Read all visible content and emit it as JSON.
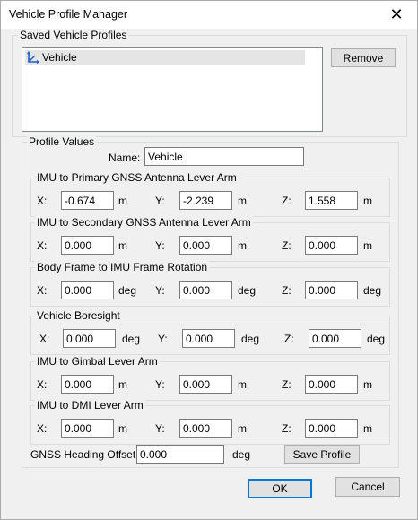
{
  "window": {
    "title": "Vehicle Profile Manager"
  },
  "saved": {
    "legend": "Saved Vehicle Profiles",
    "items": [
      {
        "label": "Vehicle",
        "icon": "axes-icon"
      }
    ],
    "remove_label": "Remove"
  },
  "values": {
    "legend": "Profile Values",
    "name_label": "Name:",
    "name_value": "Vehicle",
    "groups": [
      {
        "title": "IMU to Primary GNSS Antenna Lever Arm",
        "x": "-0.674",
        "y": "-2.239",
        "z": "1.558",
        "unit": "m"
      },
      {
        "title": "IMU to Secondary GNSS Antenna Lever Arm",
        "x": "0.000",
        "y": "0.000",
        "z": "0.000",
        "unit": "m"
      },
      {
        "title": "Body Frame to IMU Frame Rotation",
        "x": "0.000",
        "y": "0.000",
        "z": "0.000",
        "unit": "deg"
      },
      {
        "title": "Vehicle Boresight",
        "x": "0.000",
        "y": "0.000",
        "z": "0.000",
        "unit": "deg"
      },
      {
        "title": "IMU to Gimbal Lever Arm",
        "x": "0.000",
        "y": "0.000",
        "z": "0.000",
        "unit": "m"
      },
      {
        "title": "IMU to DMI Lever Arm",
        "x": "0.000",
        "y": "0.000",
        "z": "0.000",
        "unit": "m"
      }
    ],
    "axis_labels": {
      "x": "X:",
      "y": "Y:",
      "z": "Z:"
    },
    "heading_label": "GNSS Heading Offset:",
    "heading_value": "0.000",
    "heading_unit": "deg",
    "save_label": "Save Profile"
  },
  "footer": {
    "ok_label": "OK",
    "cancel_label": "Cancel"
  }
}
